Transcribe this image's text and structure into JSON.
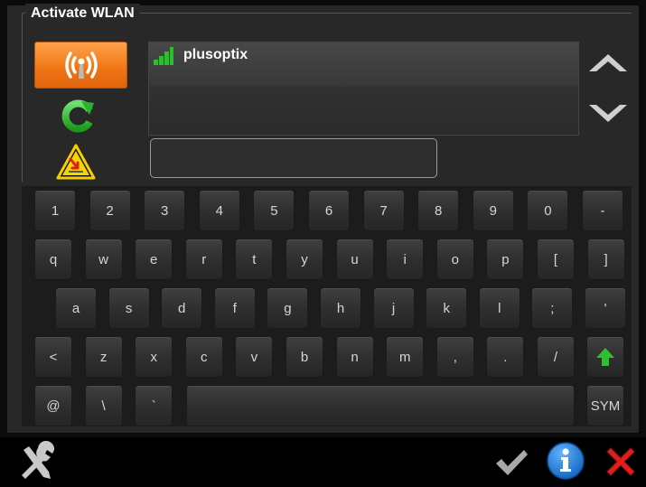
{
  "window": {
    "title": "Activate WLAN"
  },
  "network_list": {
    "networks": [
      {
        "ssid": "plusoptix"
      }
    ]
  },
  "password_field": {
    "value": "",
    "placeholder": ""
  },
  "keyboard": {
    "rows": [
      [
        "1",
        "2",
        "3",
        "4",
        "5",
        "6",
        "7",
        "8",
        "9",
        "0",
        "-"
      ],
      [
        "q",
        "w",
        "e",
        "r",
        "t",
        "y",
        "u",
        "i",
        "o",
        "p",
        "[",
        "]"
      ],
      [
        "a",
        "s",
        "d",
        "f",
        "g",
        "h",
        "j",
        "k",
        "l",
        ";",
        "'"
      ],
      [
        "<",
        "z",
        "x",
        "c",
        "v",
        "b",
        "n",
        "m",
        ",",
        ".",
        "/"
      ],
      [
        "@",
        "\\",
        "`"
      ]
    ],
    "symbols_label": "SYM",
    "shift_icon": "shift-up-arrow-icon"
  },
  "icons": {
    "wlan_toggle": "wlan-antenna-icon",
    "refresh": "refresh-icon",
    "warning": "warning-icon",
    "scroll_up": "up-arrow-icon",
    "scroll_down": "down-arrow-icon",
    "tools": "tools-icon",
    "confirm": "check-icon",
    "info": "info-icon",
    "close": "close-icon"
  },
  "colors": {
    "accent_orange": "#f07414",
    "confirm_gray": "#a8a8a8",
    "info_blue": "#1f7fd8",
    "close_red": "#e01e1e",
    "shift_green": "#2fbf2f"
  }
}
